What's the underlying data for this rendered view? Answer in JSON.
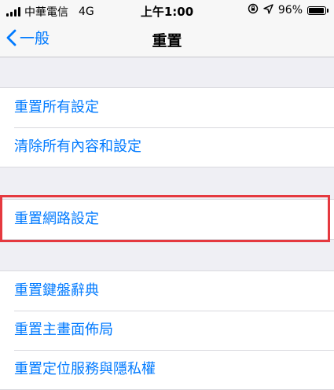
{
  "status_bar": {
    "carrier": "中華電信",
    "network": "4G",
    "time": "上午1:00",
    "battery_percent": "96%",
    "battery_level": 0.96,
    "icons": [
      "orientation-lock-icon",
      "location-arrow-icon"
    ]
  },
  "nav": {
    "back_label": "一般",
    "title": "重置"
  },
  "groups": [
    {
      "items": [
        {
          "label": "重置所有設定"
        },
        {
          "label": "清除所有內容和設定"
        }
      ]
    },
    {
      "items": [
        {
          "label": "重置網路設定",
          "highlighted": true
        }
      ]
    },
    {
      "items": [
        {
          "label": "重置鍵盤辭典"
        },
        {
          "label": "重置主畫面佈局"
        },
        {
          "label": "重置定位服務與隱私權"
        }
      ]
    }
  ],
  "colors": {
    "accent": "#007aff",
    "highlight": "#e5393f",
    "background": "#efeff4"
  }
}
